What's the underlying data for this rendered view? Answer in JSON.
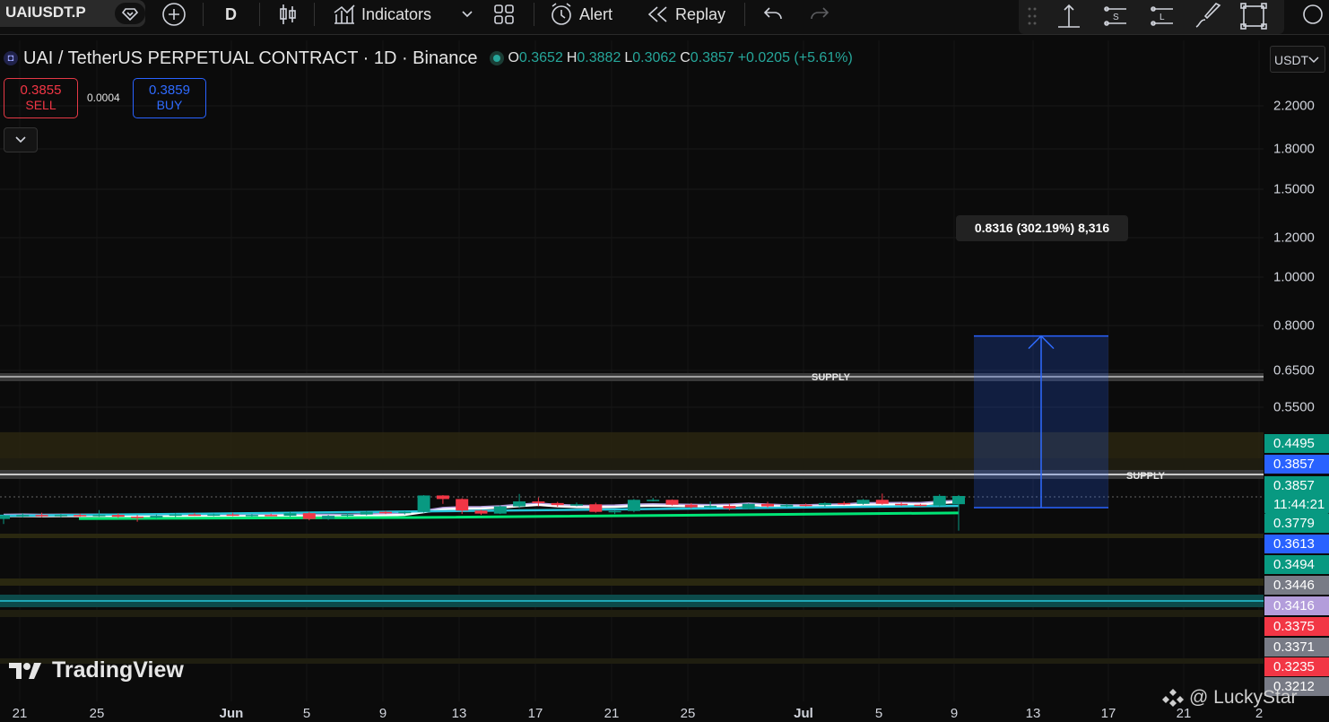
{
  "toolbar": {
    "symbol": "UAIUSDT.P",
    "interval": "D",
    "indicators_label": "Indicators",
    "alert_label": "Alert",
    "replay_label": "Replay"
  },
  "legend": {
    "title": "UAI / TetherUS PERPETUAL CONTRACT · 1D · Binance",
    "open_key": "O",
    "open": "0.3652",
    "high_key": "H",
    "high": "0.3882",
    "low_key": "L",
    "low": "0.3062",
    "close_key": "C",
    "close": "0.3857",
    "change": "+0.0205 (+5.61%)"
  },
  "trade": {
    "sell_price": "0.3855",
    "sell_label": "SELL",
    "spread": "0.0004",
    "buy_price": "0.3859",
    "buy_label": "BUY"
  },
  "price_axis": {
    "currency": "USDT",
    "ticks": [
      "2.2000",
      "1.8000",
      "1.5000",
      "1.2000",
      "1.0000",
      "0.8000",
      "0.6500",
      "0.5500"
    ],
    "labels": [
      {
        "text": "0.4495",
        "color": "#089981"
      },
      {
        "text": "0.3857",
        "color": "#2962ff"
      },
      {
        "text": "0.3857",
        "color": "#089981"
      },
      {
        "text": "11:44:21",
        "color": "#089981"
      },
      {
        "text": "0.3779",
        "color": "#089981"
      },
      {
        "text": "0.3613",
        "color": "#2962ff"
      },
      {
        "text": "0.3494",
        "color": "#089981"
      },
      {
        "text": "0.3446",
        "color": "#787b86"
      },
      {
        "text": "0.3416",
        "color": "#b39ddb"
      },
      {
        "text": "0.3375",
        "color": "#f23645"
      },
      {
        "text": "0.3371",
        "color": "#787b86"
      },
      {
        "text": "0.3235",
        "color": "#f23645"
      },
      {
        "text": "0.3212",
        "color": "#787b86"
      }
    ]
  },
  "time_axis": [
    "21",
    "25",
    "Jun",
    "5",
    "9",
    "13",
    "17",
    "21",
    "25",
    "Jul",
    "5",
    "9",
    "13",
    "17",
    "21",
    "2"
  ],
  "measure": {
    "label": "0.8316 (302.19%) 8,316"
  },
  "zones": {
    "supply_label": "SUPPLY"
  },
  "branding": {
    "logo_text": "TradingView",
    "watermark": "@ LuckyStar"
  },
  "chart_data": {
    "type": "candlestick",
    "symbol": "UAIUSDT.P",
    "timeframe": "1D",
    "y_scale": "log",
    "candles": [
      {
        "o": 0.331,
        "h": 0.34,
        "l": 0.32,
        "c": 0.339
      },
      {
        "o": 0.339,
        "h": 0.344,
        "l": 0.334,
        "c": 0.34
      },
      {
        "o": 0.34,
        "h": 0.345,
        "l": 0.335,
        "c": 0.338
      },
      {
        "o": 0.338,
        "h": 0.342,
        "l": 0.334,
        "c": 0.34
      },
      {
        "o": 0.34,
        "h": 0.343,
        "l": 0.336,
        "c": 0.339
      },
      {
        "o": 0.339,
        "h": 0.351,
        "l": 0.336,
        "c": 0.34
      },
      {
        "o": 0.34,
        "h": 0.344,
        "l": 0.333,
        "c": 0.336
      },
      {
        "o": 0.336,
        "h": 0.34,
        "l": 0.325,
        "c": 0.334
      },
      {
        "o": 0.334,
        "h": 0.341,
        "l": 0.332,
        "c": 0.338
      },
      {
        "o": 0.338,
        "h": 0.344,
        "l": 0.335,
        "c": 0.341
      },
      {
        "o": 0.341,
        "h": 0.344,
        "l": 0.338,
        "c": 0.34
      },
      {
        "o": 0.34,
        "h": 0.343,
        "l": 0.337,
        "c": 0.341
      },
      {
        "o": 0.341,
        "h": 0.345,
        "l": 0.337,
        "c": 0.339
      },
      {
        "o": 0.339,
        "h": 0.342,
        "l": 0.336,
        "c": 0.34
      },
      {
        "o": 0.34,
        "h": 0.343,
        "l": 0.337,
        "c": 0.338
      },
      {
        "o": 0.338,
        "h": 0.348,
        "l": 0.336,
        "c": 0.344
      },
      {
        "o": 0.344,
        "h": 0.347,
        "l": 0.328,
        "c": 0.331
      },
      {
        "o": 0.331,
        "h": 0.34,
        "l": 0.329,
        "c": 0.338
      },
      {
        "o": 0.338,
        "h": 0.343,
        "l": 0.336,
        "c": 0.341
      },
      {
        "o": 0.341,
        "h": 0.349,
        "l": 0.339,
        "c": 0.347
      },
      {
        "o": 0.347,
        "h": 0.349,
        "l": 0.342,
        "c": 0.345
      },
      {
        "o": 0.345,
        "h": 0.348,
        "l": 0.341,
        "c": 0.347
      },
      {
        "o": 0.347,
        "h": 0.388,
        "l": 0.345,
        "c": 0.387
      },
      {
        "o": 0.387,
        "h": 0.388,
        "l": 0.366,
        "c": 0.378
      },
      {
        "o": 0.378,
        "h": 0.38,
        "l": 0.342,
        "c": 0.35
      },
      {
        "o": 0.35,
        "h": 0.352,
        "l": 0.34,
        "c": 0.343
      },
      {
        "o": 0.343,
        "h": 0.362,
        "l": 0.342,
        "c": 0.36
      },
      {
        "o": 0.36,
        "h": 0.391,
        "l": 0.356,
        "c": 0.372
      },
      {
        "o": 0.372,
        "h": 0.382,
        "l": 0.36,
        "c": 0.368
      },
      {
        "o": 0.368,
        "h": 0.371,
        "l": 0.359,
        "c": 0.363
      },
      {
        "o": 0.363,
        "h": 0.369,
        "l": 0.36,
        "c": 0.365
      },
      {
        "o": 0.365,
        "h": 0.369,
        "l": 0.345,
        "c": 0.347
      },
      {
        "o": 0.347,
        "h": 0.35,
        "l": 0.342,
        "c": 0.349
      },
      {
        "o": 0.349,
        "h": 0.378,
        "l": 0.346,
        "c": 0.376
      },
      {
        "o": 0.376,
        "h": 0.381,
        "l": 0.372,
        "c": 0.376
      },
      {
        "o": 0.376,
        "h": 0.377,
        "l": 0.362,
        "c": 0.364
      },
      {
        "o": 0.364,
        "h": 0.368,
        "l": 0.355,
        "c": 0.358
      },
      {
        "o": 0.358,
        "h": 0.372,
        "l": 0.356,
        "c": 0.361
      },
      {
        "o": 0.361,
        "h": 0.366,
        "l": 0.351,
        "c": 0.355
      },
      {
        "o": 0.355,
        "h": 0.367,
        "l": 0.353,
        "c": 0.366
      },
      {
        "o": 0.366,
        "h": 0.371,
        "l": 0.357,
        "c": 0.36
      },
      {
        "o": 0.36,
        "h": 0.366,
        "l": 0.358,
        "c": 0.364
      },
      {
        "o": 0.364,
        "h": 0.367,
        "l": 0.36,
        "c": 0.363
      },
      {
        "o": 0.363,
        "h": 0.37,
        "l": 0.359,
        "c": 0.368
      },
      {
        "o": 0.368,
        "h": 0.372,
        "l": 0.363,
        "c": 0.366
      },
      {
        "o": 0.366,
        "h": 0.378,
        "l": 0.364,
        "c": 0.376
      },
      {
        "o": 0.376,
        "h": 0.392,
        "l": 0.364,
        "c": 0.366
      },
      {
        "o": 0.366,
        "h": 0.37,
        "l": 0.361,
        "c": 0.364
      },
      {
        "o": 0.364,
        "h": 0.366,
        "l": 0.36,
        "c": 0.362
      },
      {
        "o": 0.362,
        "h": 0.39,
        "l": 0.36,
        "c": 0.386
      },
      {
        "o": 0.3652,
        "h": 0.3882,
        "l": 0.3062,
        "c": 0.3857
      }
    ],
    "supply_zones": [
      {
        "label": "SUPPLY",
        "low": 0.4495,
        "high": 0.59
      },
      {
        "label": "SUPPLY",
        "low": 0.3857,
        "high": 0.392
      }
    ],
    "horizontal_lines": [
      0.63,
      0.3857
    ],
    "measure_tool": {
      "from": 0.3613,
      "to": 1.12,
      "text": "0.8316 (302.19%) 8,316"
    },
    "moving_averages": [
      {
        "color": "#ffffff",
        "end": 0.3779
      },
      {
        "color": "#b39ddb",
        "end": 0.3806
      },
      {
        "color": "#26c6da",
        "end": 0.3613
      },
      {
        "color": "#00e676",
        "end": 0.3446
      }
    ]
  }
}
